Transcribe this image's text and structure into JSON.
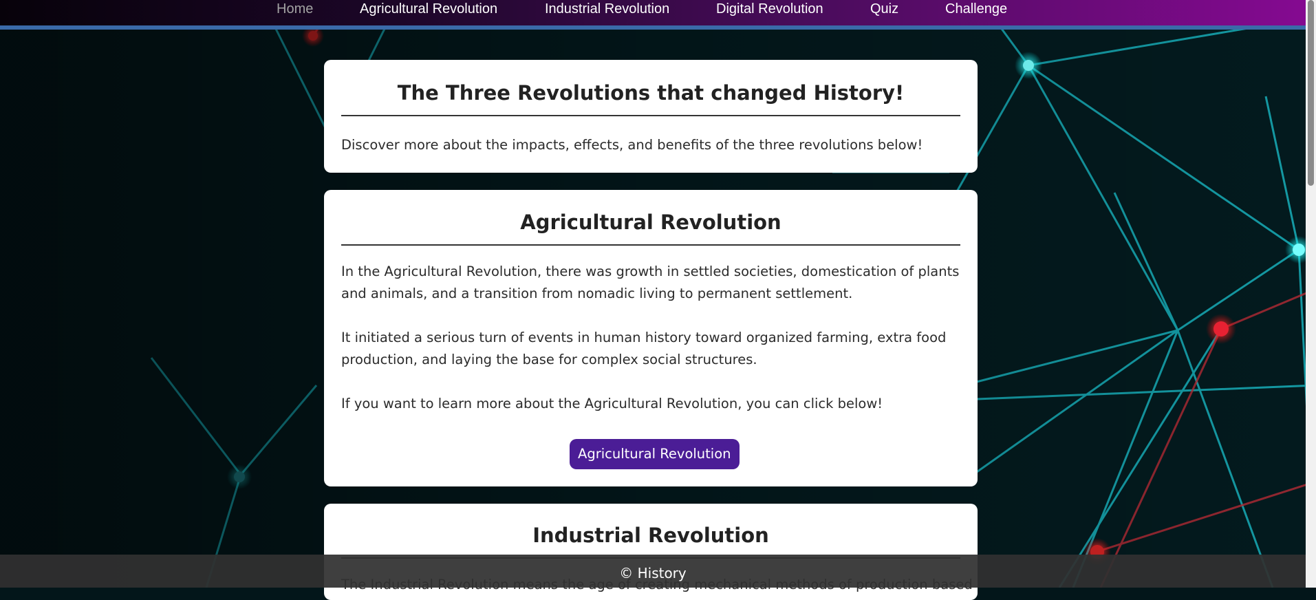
{
  "nav": {
    "items": [
      {
        "label": "Home",
        "active": true
      },
      {
        "label": "Agricultural Revolution",
        "active": false
      },
      {
        "label": "Industrial Revolution",
        "active": false
      },
      {
        "label": "Digital Revolution",
        "active": false
      },
      {
        "label": "Quiz",
        "active": false
      },
      {
        "label": "Challenge",
        "active": false
      }
    ]
  },
  "intro": {
    "title": "The Three Revolutions that changed History!",
    "text": "Discover more about the impacts, effects, and benefits of the three revolutions below!"
  },
  "agricultural": {
    "title": "Agricultural Revolution",
    "p1": "In the Agricultural Revolution, there was growth in settled societies, domestication of plants and animals, and a transition from nomadic living to permanent settlement.",
    "p2": "It initiated a serious turn of events in human history toward organized farming, extra food production, and laying the base for complex social structures.",
    "p3": "If you want to learn more about the Agricultural Revolution, you can click below!",
    "button": "Agricultural Revolution"
  },
  "industrial": {
    "title": "Industrial Revolution",
    "p1": "The Industrial Revolution means the age of creating mechanical methods of production based on"
  },
  "footer": {
    "text": "© History"
  },
  "colors": {
    "nav_start": "#07020a",
    "nav_end": "#860a92",
    "nav_border": "#3a6aa8",
    "button": "#4b1d96",
    "background": "#03161a"
  }
}
